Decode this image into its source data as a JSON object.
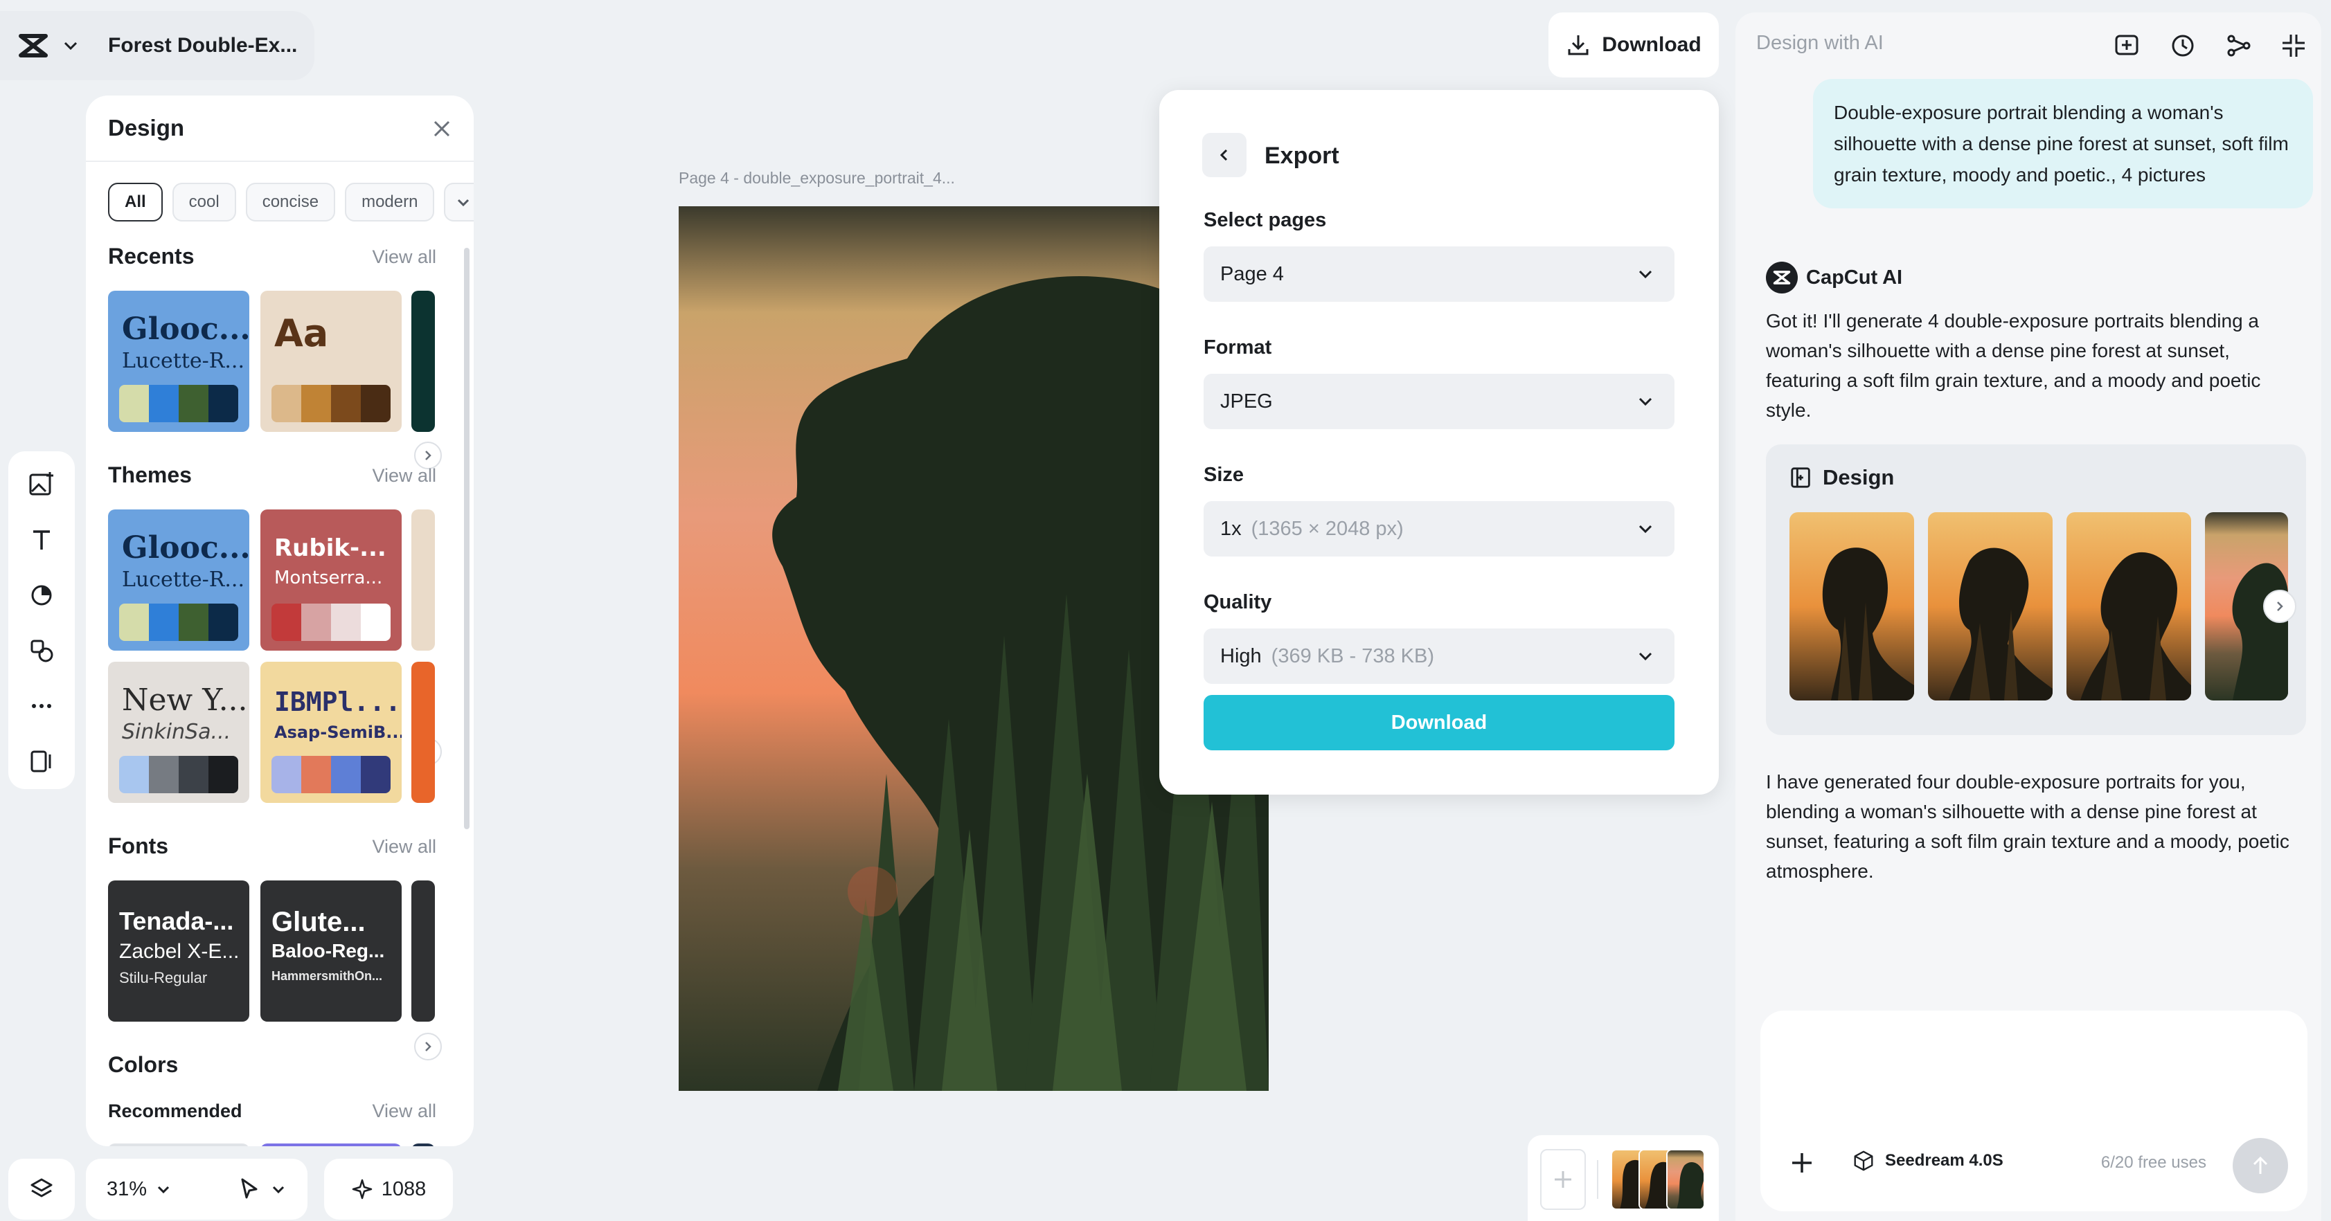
{
  "project": {
    "title": "Forest Double-Ex..."
  },
  "design_panel": {
    "title": "Design",
    "filters": [
      "All",
      "cool",
      "concise",
      "modern"
    ],
    "recents_title": "Recents",
    "themes_title": "Themes",
    "fonts_title": "Fonts",
    "colors_title": "Colors",
    "recommended_label": "Recommended",
    "view_all": "View all",
    "recents": [
      {
        "title": "Glooc...",
        "subtitle": "Lucette-R..."
      },
      {
        "title": "Aa",
        "subtitle": ""
      }
    ],
    "themes": [
      {
        "title": "Glooc...",
        "subtitle": "Lucette-R..."
      },
      {
        "title": "Rubik-...",
        "subtitle": "Montserra..."
      },
      {
        "title": "New Y...",
        "subtitle": "SinkinSa..."
      },
      {
        "title": "IBMPl...",
        "subtitle": "Asap-SemiB..."
      }
    ],
    "fonts": [
      {
        "line1": "Tenada-...",
        "line2": "Zacbel X-E...",
        "line3": "Stilu-Regular"
      },
      {
        "line1": "Glute...",
        "line2": "Baloo-Reg...",
        "line3": "HammersmithOn..."
      }
    ]
  },
  "bottom_bar": {
    "zoom": "31%",
    "credits": "1088"
  },
  "canvas": {
    "page_label": "Page 4 -   double_exposure_portrait_4..."
  },
  "top_download_label": "Download",
  "export": {
    "title": "Export",
    "select_pages_label": "Select pages",
    "select_pages_value": "Page 4",
    "format_label": "Format",
    "format_value": "JPEG",
    "size_label": "Size",
    "size_value": "1x",
    "size_hint": "(1365 × 2048 px)",
    "quality_label": "Quality",
    "quality_value": "High",
    "quality_hint": "(369 KB - 738 KB)",
    "download_label": "Download"
  },
  "chat": {
    "title": "Design with AI",
    "user_message": "Double-exposure portrait blending a woman's silhouette with a dense pine forest at sunset, soft film grain texture, moody and poetic., 4 pictures",
    "ai_name": "CapCut AI",
    "ai_intro": "Got it! I'll generate 4 double-exposure portraits blending a woman's silhouette with a dense pine forest at sunset, featuring a soft film grain texture, and a moody and poetic style.",
    "design_card_title": "Design",
    "ai_summary": "I have generated four double-exposure portraits for you, blending a woman's silhouette with a dense pine forest at sunset, featuring a soft film grain texture and a moody, poetic atmosphere.",
    "model_name": "Seedream 4.0S",
    "free_uses": "6/20 free uses"
  },
  "colors": {
    "accent": "#22c1d6",
    "user_bubble": "#dff4f7",
    "background": "#eef1f4"
  }
}
